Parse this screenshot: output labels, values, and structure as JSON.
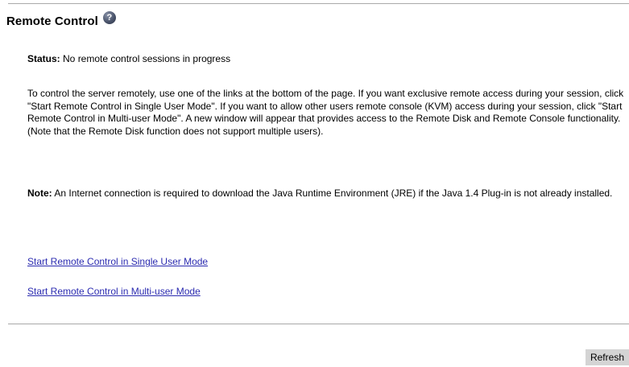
{
  "header": {
    "title": "Remote Control",
    "help_icon": "question-mark-icon",
    "help_glyph": "?"
  },
  "status": {
    "label": "Status:",
    "value": "No remote control sessions in progress"
  },
  "instructions": "To control the server remotely, use one of the links at the bottom of the page. If you want exclusive remote access during your session, click \"Start Remote Control in Single User Mode\". If you want to allow other users remote console (KVM) access during your session, click \"Start Remote Control in Multi-user Mode\". A new window will appear that provides access to the Remote Disk and Remote Console functionality. (Note that the Remote Disk function does not support multiple users).",
  "note": {
    "label": "Note:",
    "text": "An Internet connection is required to download the Java Runtime Environment (JRE) if the Java 1.4 Plug-in is not already installed."
  },
  "links": {
    "single_user": "Start Remote Control in Single User Mode",
    "multi_user": "Start Remote Control in Multi-user Mode"
  },
  "actions": {
    "refresh_label": "Refresh"
  },
  "colors": {
    "link": "#2b2bb0",
    "rule": "#a9a9a9",
    "button_bg": "#d4d4d4"
  }
}
